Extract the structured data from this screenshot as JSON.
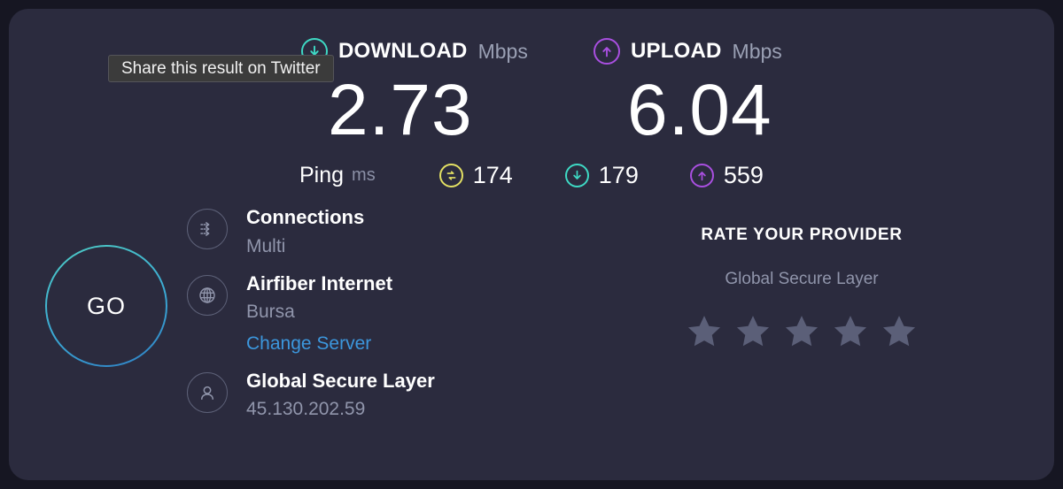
{
  "card": {
    "background_color": "#2b2b3e",
    "page_background_color": "#161622"
  },
  "tooltip": {
    "text": "Share this result on Twitter"
  },
  "download": {
    "label": "DOWNLOAD",
    "unit": "Mbps",
    "value": "2.73",
    "icon": "download-arrow-icon",
    "color": "#3ed9c4"
  },
  "upload": {
    "label": "UPLOAD",
    "unit": "Mbps",
    "value": "6.04",
    "icon": "upload-arrow-icon",
    "color": "#a94fe0"
  },
  "ping": {
    "label": "Ping",
    "unit": "ms",
    "idle": {
      "value": "174",
      "icon": "idle-latency-icon",
      "color": "#e3e063"
    },
    "download": {
      "value": "179",
      "icon": "download-arrow-icon",
      "color": "#3ed9c4"
    },
    "upload": {
      "value": "559",
      "icon": "upload-arrow-icon",
      "color": "#a94fe0"
    }
  },
  "go_button": {
    "label": "GO"
  },
  "server_info": {
    "connections": {
      "title": "Connections",
      "subtitle": "Multi",
      "icon": "multi-connection-icon"
    },
    "provider": {
      "title": "Airfiber Internet",
      "subtitle": "Bursa",
      "link": "Change Server",
      "icon": "globe-icon"
    },
    "client": {
      "title": "Global Secure Layer",
      "subtitle": "45.130.202.59",
      "icon": "person-icon"
    }
  },
  "rate_provider": {
    "heading": "RATE YOUR PROVIDER",
    "provider_name": "Global Secure Layer",
    "stars": [
      "star-1",
      "star-2",
      "star-3",
      "star-4",
      "star-5"
    ],
    "rating": 0,
    "star_color": "#5b5f78"
  }
}
